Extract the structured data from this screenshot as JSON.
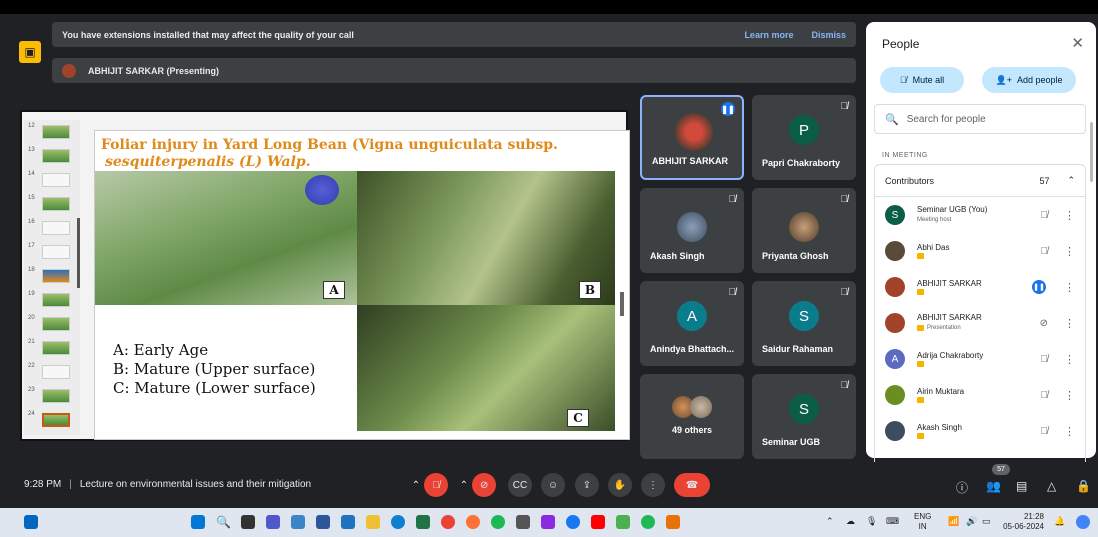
{
  "banner": {
    "message": "You have extensions installed that may affect the quality of your call",
    "learn_more": "Learn more",
    "dismiss": "Dismiss"
  },
  "presenter": {
    "label": "ABHIJIT SARKAR (Presenting)"
  },
  "slide": {
    "title_line1": "Foliar injury in Yard Long Bean (Vigna unguiculata subsp.",
    "title_line2": "sesquiterpenalis (L) Walp.",
    "label_a": "A",
    "label_b": "B",
    "label_c": "C",
    "legend": [
      "A: Early Age",
      "B: Mature (Upper surface)",
      "C: Mature (Lower surface)"
    ],
    "thumb_numbers": [
      "12",
      "13",
      "14",
      "15",
      "16",
      "17",
      "18",
      "19",
      "20",
      "21",
      "22",
      "23",
      "24"
    ]
  },
  "tiles": [
    {
      "name": "ABHIJIT SARKAR",
      "initial": ""
    },
    {
      "name": "Papri Chakraborty",
      "initial": "P"
    },
    {
      "name": "Akash Singh",
      "initial": ""
    },
    {
      "name": "Priyanta Ghosh",
      "initial": ""
    },
    {
      "name": "Anindya Bhattach...",
      "initial": "A"
    },
    {
      "name": "Saidur Rahaman",
      "initial": "S"
    },
    {
      "name": "49 others",
      "initial": ""
    },
    {
      "name": "Seminar UGB",
      "initial": "S"
    }
  ],
  "people": {
    "title": "People",
    "mute_all": "Mute all",
    "add_people": "Add people",
    "search_placeholder": "Search for people",
    "in_meeting": "IN MEETING",
    "contributors": "Contributors",
    "count": "57",
    "list": [
      {
        "name": "Seminar UGB (You)",
        "sub": "Meeting host",
        "initial": "S",
        "color": "#0b5e45"
      },
      {
        "name": "Abhi Das",
        "sub": "",
        "initial": "",
        "color": "#5a4a3a"
      },
      {
        "name": "ABHIJIT SARKAR",
        "sub": "",
        "initial": "",
        "color": "#a1432a"
      },
      {
        "name": "ABHIJIT SARKAR",
        "sub": "Presentation",
        "initial": "",
        "color": "#a1432a"
      },
      {
        "name": "Adrija Chakraborty",
        "sub": "",
        "initial": "A",
        "color": "#5c6bc0"
      },
      {
        "name": "Airin Muktara",
        "sub": "",
        "initial": "",
        "color": "#6b8e23"
      },
      {
        "name": "Akash Singh",
        "sub": "",
        "initial": "",
        "color": "#3d4c5e"
      }
    ]
  },
  "bottom": {
    "time": "9:28 PM",
    "meeting_title": "Lecture on environmental issues and their mitigation",
    "people_count": "57"
  },
  "taskbar": {
    "lang_line1": "ENG",
    "lang_line2": "IN",
    "clock_time": "21:28",
    "clock_date": "05-06-2024"
  }
}
